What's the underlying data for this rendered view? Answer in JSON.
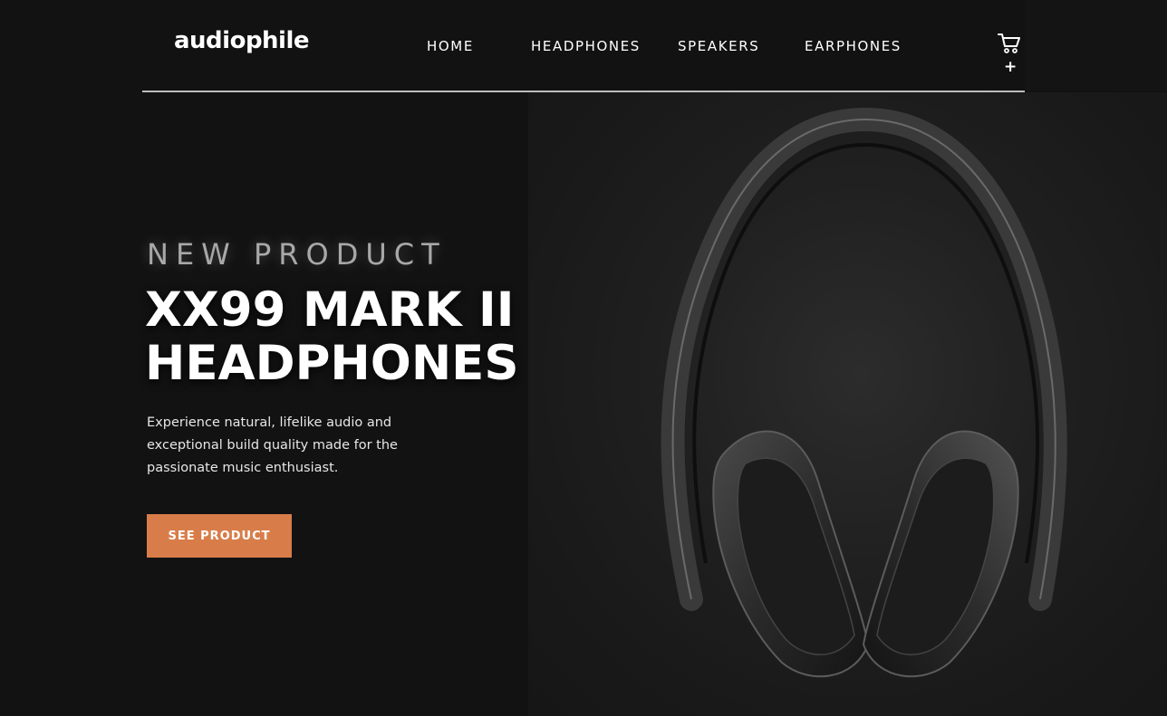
{
  "header": {
    "logo": "audiophile",
    "nav": [
      {
        "label": "HOME"
      },
      {
        "label": "HEADPHONES"
      },
      {
        "label": "SPEAKERS"
      },
      {
        "label": "EARPHONES"
      }
    ],
    "cart_icon": "cart-icon",
    "cart_add_symbol": "+"
  },
  "hero": {
    "eyebrow": "NEW PRODUCT",
    "title_line1": "XX99 MARK II",
    "title_line2": "HEADPHONES",
    "description": "Experience natural, lifelike audio and exceptional build quality made for the passionate music enthusiast.",
    "cta_label": "SEE PRODUCT",
    "image_subject": "headphones-image"
  },
  "colors": {
    "background": "#121212",
    "accent": "#d87d4a",
    "text": "#ffffff"
  }
}
